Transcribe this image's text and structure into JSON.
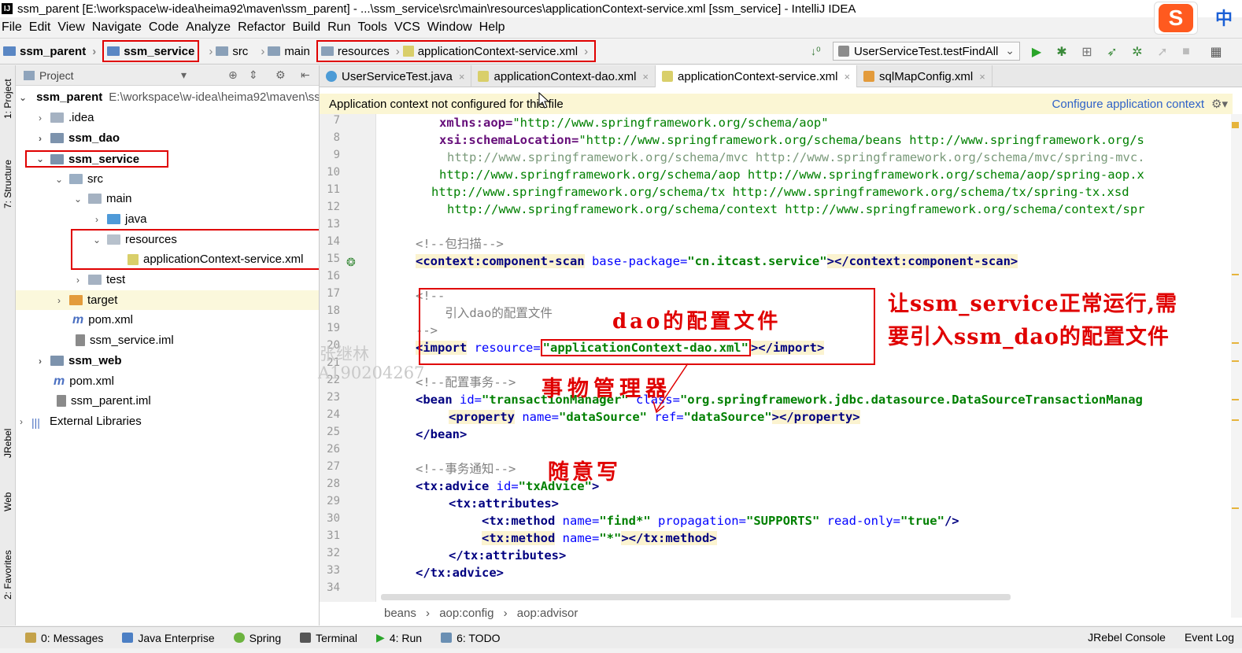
{
  "window": {
    "title": "ssm_parent [E:\\workspace\\w-idea\\heima92\\maven\\ssm_parent] - ...\\ssm_service\\src\\main\\resources\\applicationContext-service.xml [ssm_service] - IntelliJ IDEA",
    "app_badge": "IJ",
    "ime_logo": "S",
    "ime_lang": "中"
  },
  "menu": [
    "File",
    "Edit",
    "View",
    "Navigate",
    "Code",
    "Analyze",
    "Refactor",
    "Build",
    "Run",
    "Tools",
    "VCS",
    "Window",
    "Help"
  ],
  "breadcrumbs": [
    "ssm_parent",
    "ssm_service",
    "src",
    "main",
    "resources",
    "applicationContext-service.xml"
  ],
  "run_config": "UserServiceTest.testFindAll",
  "project_panel": {
    "title": "Project",
    "tree": [
      {
        "label": "ssm_parent",
        "path": "E:\\workspace\\w-idea\\heima92\\maven\\ssm_parent",
        "bold": true
      },
      {
        "label": ".idea"
      },
      {
        "label": "ssm_dao",
        "bold": true
      },
      {
        "label": "ssm_service",
        "bold": true
      },
      {
        "label": "src"
      },
      {
        "label": "main"
      },
      {
        "label": "java"
      },
      {
        "label": "resources"
      },
      {
        "label": "applicationContext-service.xml"
      },
      {
        "label": "test"
      },
      {
        "label": "target"
      },
      {
        "label": "pom.xml"
      },
      {
        "label": "ssm_service.iml"
      },
      {
        "label": "ssm_web",
        "bold": true
      },
      {
        "label": "pom.xml"
      },
      {
        "label": "ssm_parent.iml"
      },
      {
        "label": "External Libraries"
      }
    ]
  },
  "side_tabs": [
    "1: Project",
    "7: Structure",
    "JRebel",
    "Web",
    "2: Favorites"
  ],
  "tabs": [
    "UserServiceTest.java",
    "applicationContext-dao.xml",
    "applicationContext-service.xml",
    "sqlMapConfig.xml"
  ],
  "banner": {
    "message": "Application context not configured for this file",
    "action": "Configure application context"
  },
  "line_numbers": [
    "7",
    "8",
    "9",
    "10",
    "11",
    "12",
    "13",
    "14",
    "15",
    "16",
    "17",
    "18",
    "19",
    "20",
    "21",
    "22",
    "23",
    "24",
    "25",
    "26",
    "27",
    "28",
    "29",
    "30",
    "31",
    "32",
    "33",
    "34"
  ],
  "code": {
    "l7_attr": "xmlns:aop=",
    "l7_val": "\"http://www.springframework.org/schema/aop\"",
    "l8_attr": "xsi:schemaLocation=",
    "l8_val": "\"http://www.springframework.org/schema/beans http://www.springframework.org/s",
    "l9": "http://www.springframework.org/schema/mvc http://www.springframework.org/schema/mvc/spring-mvc.",
    "l10": "http://www.springframework.org/schema/aop http://www.springframework.org/schema/aop/spring-aop.x",
    "l11": "http://www.springframework.org/schema/tx http://www.springframework.org/schema/tx/spring-tx.xsd",
    "l12": "http://www.springframework.org/schema/context http://www.springframework.org/schema/context/spr",
    "l14": "<!--包扫描-->",
    "l15_open": "<context:component-scan",
    "l15_attr": " base-package=",
    "l15_val": "\"cn.itcast.service\"",
    "l15_close": "></context:component-scan>",
    "l17": "<!--",
    "l18": "    引入dao的配置文件",
    "l19": "-->",
    "l20_open": "<import",
    "l20_attr": " resource=",
    "l20_val": "\"applicationContext-dao.xml\"",
    "l20_close": "></import>",
    "l22": "<!--配置事务-->",
    "l23_open": "<bean",
    "l23_attr1": " id=",
    "l23_val1": "\"transactionManager\"",
    "l23_attr2": " class=",
    "l23_val2": "\"org.springframework.jdbc.datasource.DataSourceTransactionManag",
    "l24_open": "<property",
    "l24_attr1": " name=",
    "l24_val1": "\"dataSource\"",
    "l24_attr2": " ref=",
    "l24_val2": "\"dataSource\"",
    "l24_close": "></property>",
    "l25": "</bean>",
    "l27": "<!--事务通知-->",
    "l28_open": "<tx:advice",
    "l28_attr": " id=",
    "l28_val": "\"txAdvice\"",
    "l28_close": ">",
    "l29": "<tx:attributes>",
    "l30_open": "<tx:method",
    "l30_attr1": " name=",
    "l30_val1": "\"find*\"",
    "l30_attr2": " propagation=",
    "l30_val2": "\"SUPPORTS\"",
    "l30_attr3": " read-only=",
    "l30_val3": "\"true\"",
    "l30_close": "/>",
    "l31_open": "<tx:method",
    "l31_attr": " name=",
    "l31_val": "\"*\"",
    "l31_close": "></tx:method>",
    "l32": "</tx:attributes>",
    "l33": "</tx:advice>"
  },
  "annotations": {
    "dao_config": "dao的配置文件",
    "tx_manager": "事物管理器",
    "note_line1": "让ssm_service正常运行,需",
    "note_line2": "要引入ssm_dao的配置文件",
    "free_write": "随意写"
  },
  "watermark": {
    "name": "张继林",
    "id": "A190204267"
  },
  "editor_breadcrumb": [
    "beans",
    "aop:config",
    "aop:advisor"
  ],
  "bottom_tabs": [
    "0: Messages",
    "Java Enterprise",
    "Spring",
    "Terminal",
    "4: Run",
    "6: TODO"
  ],
  "bottom_right": [
    "JRebel Console",
    "Event Log"
  ],
  "colors": {
    "accent_red": "#e00000",
    "banner_bg": "#fbf6d4",
    "link": "#2f62c8"
  }
}
